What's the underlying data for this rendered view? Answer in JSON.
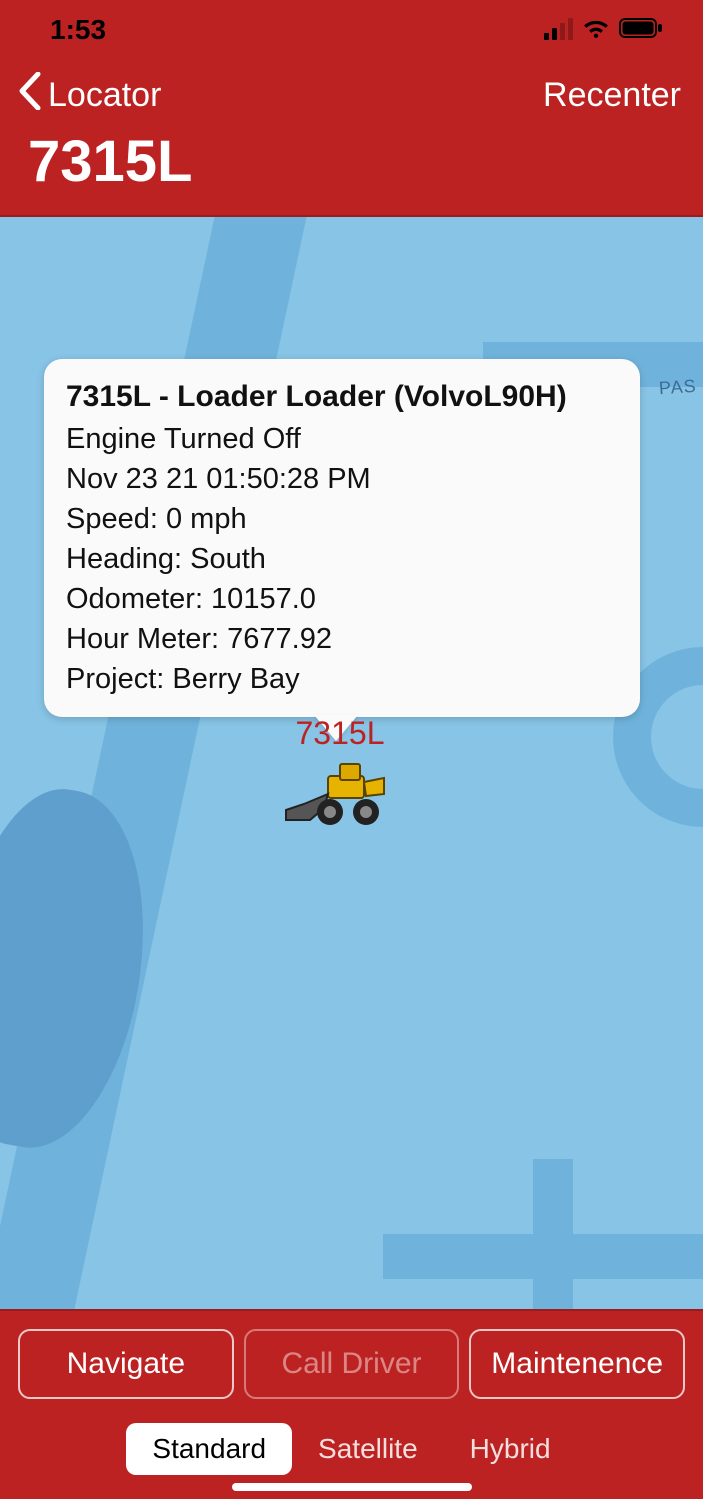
{
  "status": {
    "time": "1:53"
  },
  "nav": {
    "back_label": "Locator",
    "recenter_label": "Recenter"
  },
  "title": "7315L",
  "map": {
    "road_label": "PAS",
    "marker_label": "7315L",
    "callout": {
      "title": "7315L - Loader Loader (VolvoL90H)",
      "engine_status": "Engine Turned Off",
      "timestamp": "Nov 23 21 01:50:28 PM",
      "speed": "Speed: 0 mph",
      "heading": "Heading: South",
      "odometer": "Odometer: 10157.0",
      "hour_meter": "Hour Meter: 7677.92",
      "project": "Project: Berry Bay"
    }
  },
  "actions": {
    "buttons": [
      {
        "label": "Navigate",
        "enabled": true
      },
      {
        "label": "Call Driver",
        "enabled": false
      },
      {
        "label": "Maintenence",
        "enabled": true
      }
    ]
  },
  "map_modes": {
    "items": [
      "Standard",
      "Satellite",
      "Hybrid"
    ],
    "active": "Standard"
  }
}
